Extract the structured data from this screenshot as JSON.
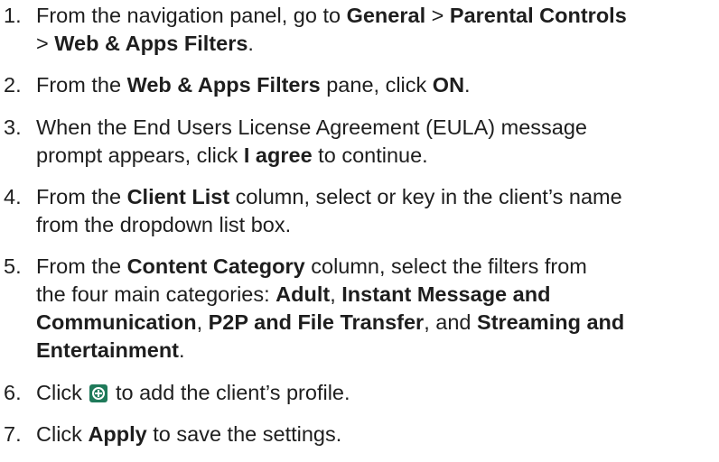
{
  "steps": [
    {
      "number": "1.",
      "lines": [
        [
          {
            "text": "From the navigation panel, go to "
          },
          {
            "text": "General",
            "bold": true
          },
          {
            "text": " > "
          },
          {
            "text": "Parental Controls",
            "bold": true
          }
        ],
        [
          {
            "text": "> "
          },
          {
            "text": "Web & Apps Filters",
            "bold": true
          },
          {
            "text": "."
          }
        ]
      ]
    },
    {
      "number": "2.",
      "lines": [
        [
          {
            "text": "From the "
          },
          {
            "text": "Web & Apps Filters",
            "bold": true
          },
          {
            "text": " pane, click "
          },
          {
            "text": "ON",
            "bold": true
          },
          {
            "text": "."
          }
        ]
      ]
    },
    {
      "number": "3.",
      "lines": [
        [
          {
            "text": "When the End Users License Agreement (EULA) message"
          }
        ],
        [
          {
            "text": "prompt appears, click "
          },
          {
            "text": "I agree",
            "bold": true
          },
          {
            "text": " to continue."
          }
        ]
      ]
    },
    {
      "number": "4.",
      "lines": [
        [
          {
            "text": "From the "
          },
          {
            "text": "Client List",
            "bold": true
          },
          {
            "text": " column, select or key in the client’s name"
          }
        ],
        [
          {
            "text": "from the dropdown list box."
          }
        ]
      ]
    },
    {
      "number": "5.",
      "lines": [
        [
          {
            "text": "From the "
          },
          {
            "text": "Content Category",
            "bold": true
          },
          {
            "text": " column, select the filters from"
          }
        ],
        [
          {
            "text": "the four main categories: "
          },
          {
            "text": "Adult",
            "bold": true
          },
          {
            "text": ", "
          },
          {
            "text": "Instant Message and",
            "bold": true
          }
        ],
        [
          {
            "text": "Communication",
            "bold": true
          },
          {
            "text": ", "
          },
          {
            "text": "P2P and File Transfer",
            "bold": true
          },
          {
            "text": ", and "
          },
          {
            "text": "Streaming and",
            "bold": true
          }
        ],
        [
          {
            "text": "Entertainment",
            "bold": true
          },
          {
            "text": "."
          }
        ]
      ]
    },
    {
      "number": "6.",
      "lines": [
        [
          {
            "text": "Click "
          },
          {
            "icon": "add-circle-icon"
          },
          {
            "text": " to add the client’s profile."
          }
        ]
      ]
    },
    {
      "number": "7.",
      "lines": [
        [
          {
            "text": "Click "
          },
          {
            "text": "Apply",
            "bold": true
          },
          {
            "text": " to save the settings."
          }
        ]
      ]
    }
  ],
  "colors": {
    "text": "#1e1e1e",
    "icon_background": "#1f7a5a",
    "icon_foreground": "#ffffff"
  }
}
